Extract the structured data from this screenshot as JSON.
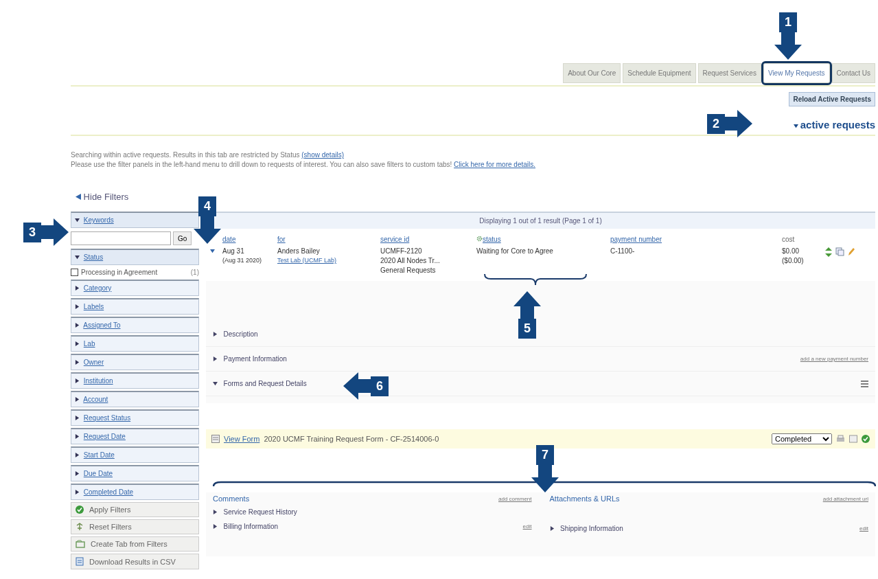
{
  "tabs": [
    {
      "label": "About Our Core",
      "selected": false
    },
    {
      "label": "Schedule Equipment",
      "selected": false
    },
    {
      "label": "Request Services",
      "selected": false
    },
    {
      "label": "View My Requests",
      "selected": true
    },
    {
      "label": "Contact Us",
      "selected": false
    }
  ],
  "reload_button": "Reload Active Requests",
  "section_title": {
    "label": "active requests",
    "expanded": true
  },
  "intro": {
    "line_1": "Searching within active requests. Results in this tab are restricted by Status",
    "line_1_link": "(show details)",
    "line_2": "Please use the filter panels in the left-hand menu to drill down to requests of interest. You can also save filters to custom tabs!",
    "line_2_link": "Click here for more details."
  },
  "hide_filters": "Hide Filters",
  "filters": [
    {
      "label": "Keywords",
      "expanded": true,
      "kind": "search",
      "button": "Go"
    },
    {
      "label": "Status",
      "expanded": true,
      "kind": "checklist",
      "options": [
        {
          "label": "Processing in Agreement",
          "count": "(1)",
          "checked": false
        }
      ]
    },
    {
      "label": "Category",
      "expanded": false
    },
    {
      "label": "Labels",
      "expanded": false
    },
    {
      "label": "Assigned To",
      "expanded": false
    },
    {
      "label": "Lab",
      "expanded": false
    },
    {
      "label": "Owner",
      "expanded": false
    },
    {
      "label": "Institution",
      "expanded": false
    },
    {
      "label": "Account",
      "expanded": false
    },
    {
      "label": "Request Status",
      "expanded": false
    },
    {
      "label": "Request Date",
      "expanded": false
    },
    {
      "label": "Start Date",
      "expanded": false
    },
    {
      "label": "Due Date",
      "expanded": false
    },
    {
      "label": "Completed Date",
      "expanded": false
    }
  ],
  "filter_actions": [
    {
      "label": "Apply Filters",
      "kind": "apply"
    },
    {
      "label": "Reset Filters",
      "kind": "reset"
    },
    {
      "label": "Create Tab from Filters",
      "kind": "tab"
    },
    {
      "label": "Download Results in CSV",
      "kind": "download"
    }
  ],
  "table": {
    "caption": "Displaying 1 out of 1 result (Page 1 of 1)",
    "columns": [
      "date",
      "for",
      "service id",
      "status",
      "payment number",
      "cost"
    ],
    "rows": [
      {
        "expanded": true,
        "date": "Aug 31",
        "date_full": "(Aug 31 2020)",
        "for": "Anders Bailey",
        "for_lab": "Test Lab (UCMF Lab)",
        "service_id": "UCMFF-2120",
        "service_name": "2020 All Nodes Tr...",
        "service_category": "General Requests",
        "status": "Waiting for Core to Agree",
        "payment_number": "C-1100-",
        "cost": "$0.00",
        "cost_total": "($0.00)"
      }
    ]
  },
  "details": [
    {
      "label": "Description",
      "expanded": false
    },
    {
      "label": "Payment Information",
      "expanded": false,
      "link": "add a new payment number"
    },
    {
      "label": "Forms and Request Details",
      "expanded": true
    }
  ],
  "form_row": {
    "link": "View Form",
    "title": "2020 UCMF Training Request Form - CF-2514006-0",
    "status": "Completed"
  },
  "comments": {
    "title": "Comments",
    "action": "add comment"
  },
  "attachments": {
    "title": "Attachments & URLs",
    "action": "add attachment url"
  },
  "bottom_sections": [
    {
      "label": "Service Request History",
      "expanded": false
    },
    {
      "label": "Billing Information",
      "expanded": false,
      "action": "edit"
    },
    {
      "label": "Shipping Information",
      "expanded": false,
      "action": "edit"
    }
  ],
  "callouts": [
    "1",
    "2",
    "3",
    "4",
    "5",
    "6",
    "7"
  ]
}
